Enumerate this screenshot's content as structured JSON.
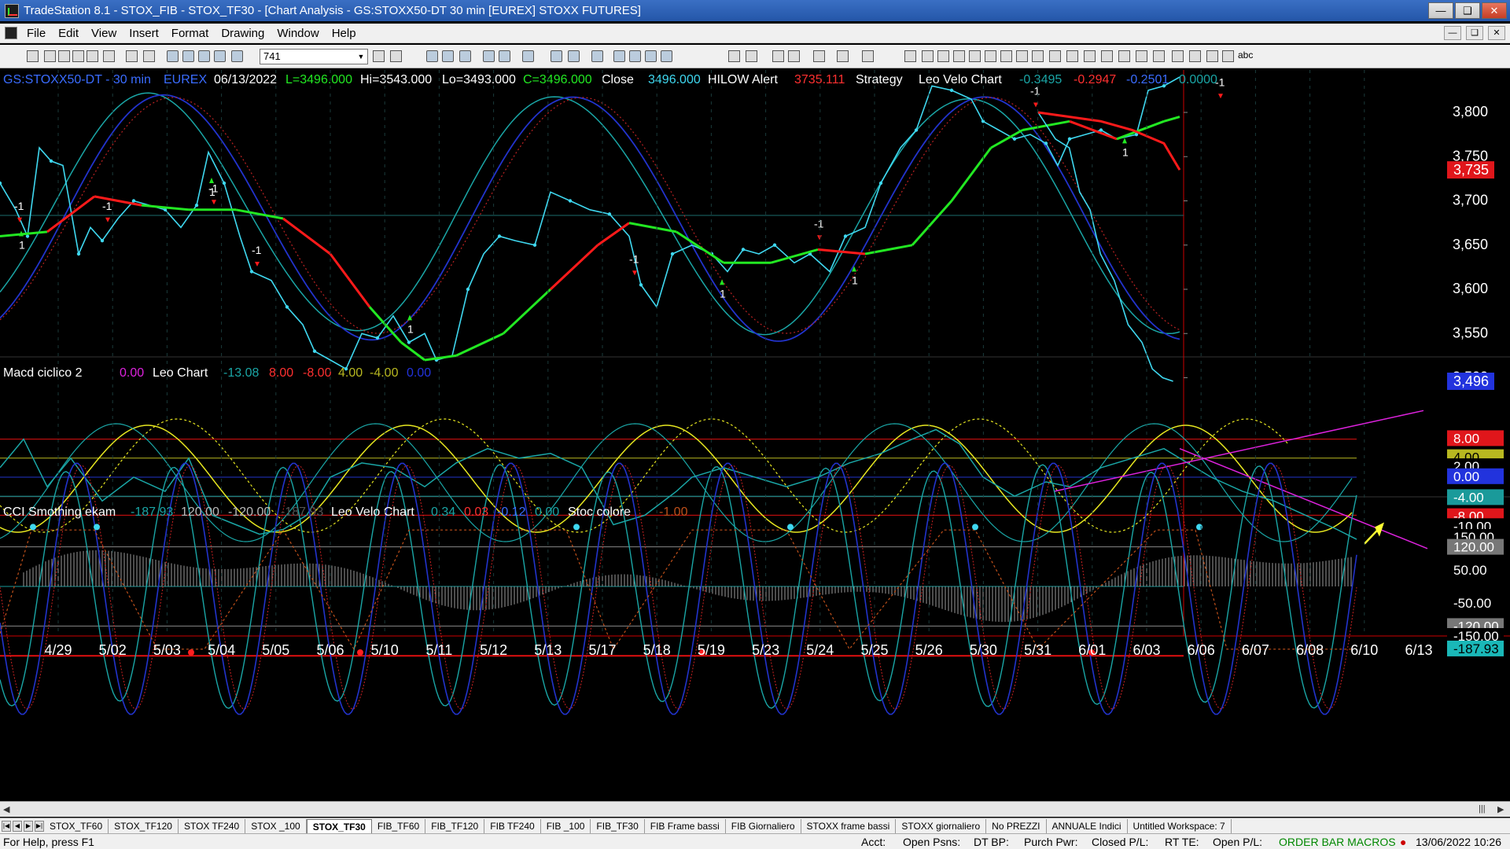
{
  "window": {
    "title": "TradeStation 8.1 - STOX_FIB - STOX_TF30 - [Chart Analysis - GS:STOXX50-DT  30 min  [EUREX] STOXX FUTURES]"
  },
  "menu": [
    "File",
    "Edit",
    "View",
    "Insert",
    "Format",
    "Drawing",
    "Window",
    "Help"
  ],
  "toolbar": {
    "symbol": "741",
    "abc_label": "abc"
  },
  "chart_header": {
    "symbol": "GS:STOXX50-DT - 30 min",
    "exchange": "EUREX",
    "date": "06/13/2022",
    "last": "L=3496.000",
    "hi": "Hi=3543.000",
    "lo": "Lo=3493.000",
    "close_eq": "C=3496.000",
    "close_label": "Close",
    "close_val": "3496.000",
    "hilow_label": "HILOW Alert",
    "hilow_val": "3735.111",
    "strategy_label": "Strategy",
    "leo_label": "Leo Velo Chart",
    "leo_v1": "-0.3495",
    "leo_v2": "-0.2947",
    "leo_v3": "-0.2501",
    "leo_v4": "0.0000"
  },
  "macd_header": {
    "name": "Macd ciclico 2",
    "v0": "0.00",
    "leo": "Leo Chart",
    "v1": "-13.08",
    "v2": "8.00",
    "v3": "-8.00",
    "v4": "4.00",
    "v5": "-4.00",
    "v6": "0.00"
  },
  "cci_header": {
    "name": "CCI Smothing ekam",
    "v1": "-187.93",
    "v2": "120.00",
    "v3": "-120.00",
    "v4": "-187.93",
    "leo": "Leo Velo Chart",
    "l1": "0.34",
    "l2": "0.03",
    "l3": "-0.12",
    "l4": "0.00",
    "stoc": "Stoc colore",
    "stoc_val": "-1.00"
  },
  "price_axis": [
    "3,800",
    "3,750",
    "3,700",
    "3,650",
    "3,600",
    "3,550",
    "3,500"
  ],
  "price_markers": {
    "hilow": "3,735",
    "last": "3,496"
  },
  "macd_axis": [
    "8.00",
    "4.00",
    "2.00",
    "0.00",
    "-4.00",
    "-8.00",
    "-10.00",
    "-13.08"
  ],
  "cci_axis": [
    "150.00",
    "120.00",
    "50.00",
    "-50.00",
    "-120.00",
    "-150.00",
    "-187.93"
  ],
  "dates": [
    "4/29",
    "5/02",
    "5/03",
    "5/04",
    "5/05",
    "5/06",
    "5/10",
    "5/11",
    "5/12",
    "5/13",
    "5/17",
    "5/18",
    "5/19",
    "5/23",
    "5/24",
    "5/25",
    "5/26",
    "5/30",
    "5/31",
    "6/01",
    "6/03",
    "6/06",
    "6/07",
    "6/08",
    "6/10",
    "6/13"
  ],
  "signal_label": "-1",
  "buy_label": "1",
  "tabs": [
    "STOX_TF60",
    "STOX_TF120",
    "STOX TF240",
    "STOX _100",
    "STOX_TF30",
    "FIB_TF60",
    "FIB_TF120",
    "FIB TF240",
    "FIB _100",
    "FIB_TF30",
    "FIB Frame bassi",
    "FIB Giornaliero",
    "STOXX frame bassi",
    "STOXX giornaliero",
    "No PREZZI",
    "ANNUALE Indici",
    "Untitled Workspace: 7"
  ],
  "active_tab": 4,
  "status": {
    "help": "For Help, press F1",
    "acct": "Acct:",
    "open_psns": "Open Psns:",
    "dtbp": "DT BP:",
    "purch": "Purch Pwr:",
    "closed": "Closed P/L:",
    "rtte": "RT TE:",
    "open_pl": "Open P/L:",
    "mode": "ORDER BAR  MACROS",
    "datetime": "13/06/2022 10:26"
  },
  "colors": {
    "price": "#3fd8f0",
    "red": "#ff1a1a",
    "green": "#22e822",
    "blue": "#2233cc",
    "teal": "#1aa6a6",
    "yellow": "#e8e820",
    "magenta": "#dd22dd",
    "axis_bg": "#000000"
  }
}
